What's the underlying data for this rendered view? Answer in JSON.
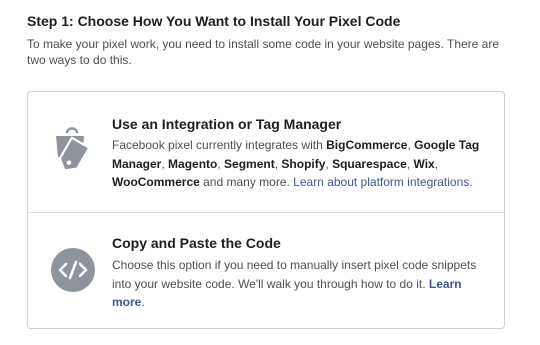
{
  "header": {
    "title": "Step 1: Choose How You Want to Install Your Pixel Code",
    "description": "To make your pixel work, you need to install some code in your website pages. There are two ways to do this."
  },
  "options": [
    {
      "icon": "shopping-bag-tag-icon",
      "title": "Use an Integration or Tag Manager",
      "body_prefix": "Facebook pixel currently integrates with ",
      "platforms": [
        "BigCommerce",
        "Google Tag Manager",
        "Magento",
        "Segment",
        "Shopify",
        "Squarespace",
        "Wix",
        "WooCommerce"
      ],
      "separator": ", ",
      "body_suffix": " and many more. ",
      "link": "Learn about platform integrations",
      "link_suffix": "."
    },
    {
      "icon": "code-icon",
      "title": "Copy and Paste the Code",
      "body": "Choose this option if you need to manually insert pixel code snippets into your website code. We'll walk you through how to do it. ",
      "link": "Learn more",
      "link_suffix": "."
    }
  ],
  "colors": {
    "icon_gray": "#8d949e",
    "link": "#385898",
    "border": "#ccd0d5",
    "text_secondary": "#4b4f56"
  }
}
